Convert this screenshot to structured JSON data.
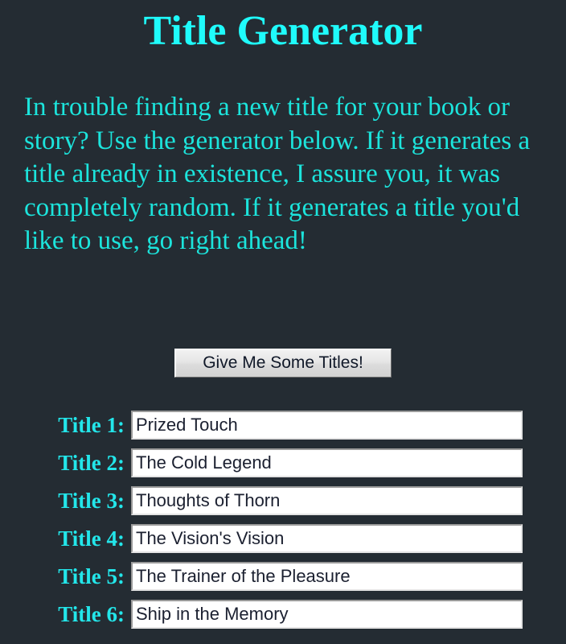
{
  "page": {
    "title": "Title Generator",
    "background_color": "#242c33",
    "accent_color": "#1ffbfb",
    "label_color": "#23e6ea",
    "intro": "In trouble finding a new title for your book or story? Use the generator below. If it generates a title already in existence, I assure you, it was completely random. If it generates a title you'd like to use, go right ahead!"
  },
  "generator": {
    "button_label": "Give Me Some Titles!"
  },
  "titles": [
    {
      "label": "Title 1:",
      "value": "Prized Touch"
    },
    {
      "label": "Title 2:",
      "value": "The Cold Legend"
    },
    {
      "label": "Title 3:",
      "value": "Thoughts of Thorn"
    },
    {
      "label": "Title 4:",
      "value": "The Vision's Vision"
    },
    {
      "label": "Title 5:",
      "value": "The Trainer of the Pleasure"
    },
    {
      "label": "Title 6:",
      "value": "Ship in the Memory"
    }
  ]
}
